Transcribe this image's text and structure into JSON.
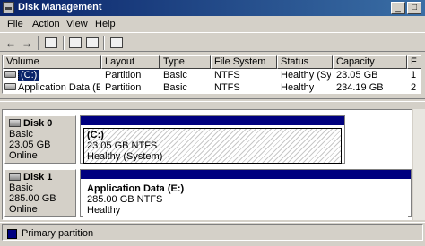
{
  "window": {
    "title": "Disk Management",
    "buttons": {
      "minimize": "_",
      "maximize": "□"
    }
  },
  "menu": [
    "File",
    "Action",
    "View",
    "Help"
  ],
  "volumes": {
    "columns": [
      "Volume",
      "Layout",
      "Type",
      "File System",
      "Status",
      "Capacity",
      "F"
    ],
    "rows": [
      {
        "volume": "(C:)",
        "layout": "Partition",
        "type": "Basic",
        "fs": "NTFS",
        "status": "Healthy (Sy...",
        "capacity": "23.05 GB",
        "extra": "1"
      },
      {
        "volume": "Application Data (E:)",
        "layout": "Partition",
        "type": "Basic",
        "fs": "NTFS",
        "status": "Healthy",
        "capacity": "234.19 GB",
        "extra": "2"
      }
    ]
  },
  "disks": [
    {
      "name": "Disk 0",
      "type": "Basic",
      "size": "23.05 GB",
      "state": "Online",
      "partition": {
        "name": "(C:)",
        "detail": "23.05 GB NTFS",
        "status": "Healthy (System)"
      }
    },
    {
      "name": "Disk 1",
      "type": "Basic",
      "size": "285.00 GB",
      "state": "Online",
      "partition": {
        "name": "Application Data  (E:)",
        "detail": "285.00 GB NTFS",
        "status": "Healthy"
      }
    }
  ],
  "legend": {
    "label": "Primary partition",
    "color": "#00007f"
  },
  "colors": {
    "title_bar": "#0a246a",
    "partition_bar": "#00007f",
    "chrome": "#d4d0c8"
  },
  "icons": [
    "back-arrow-icon",
    "forward-arrow-icon",
    "up-folder-icon",
    "properties-icon",
    "help-icon",
    "volume-icon",
    "disk-icon"
  ]
}
